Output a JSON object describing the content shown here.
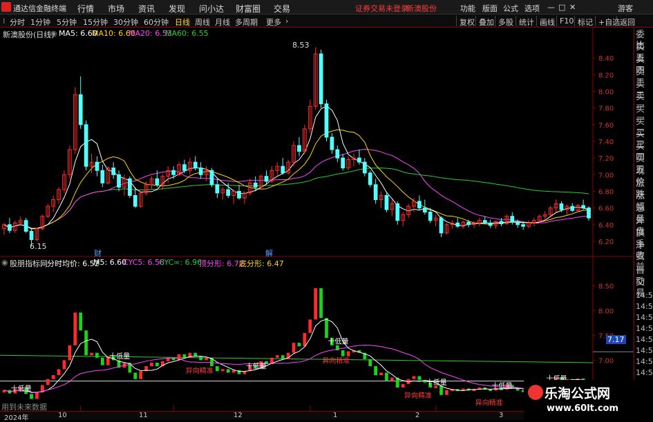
{
  "titlebar": {
    "app": "通达信金融终端",
    "menu": [
      "行情",
      "市场",
      "资讯",
      "发现",
      "问小达",
      "财富圈",
      "交易"
    ],
    "alert1": "证券交易未登录",
    "alert2": "新澳股份",
    "right": [
      "功能",
      "版面",
      "公式",
      "选项"
    ],
    "guest": "游客",
    "win": [
      "—",
      "□",
      "✕"
    ]
  },
  "tabs": {
    "items": [
      "分时",
      "1分钟",
      "5分钟",
      "15分钟",
      "30分钟",
      "60分钟",
      "日线",
      "周线",
      "月线",
      "多周期",
      "更多"
    ],
    "active": 6,
    "right": [
      "复权",
      "叠加",
      "多股",
      "统计",
      "画线",
      "F10",
      "标记",
      "+自选",
      "返回"
    ]
  },
  "main": {
    "title": "新澳股份(日线)",
    "ma5": "MA5: 6.60",
    "ma10": "MA10: 6.60",
    "ma20": "MA20: 6.53",
    "ma60": "MA60: 6.55",
    "hi_label": "8.53",
    "lo_label": "6.15",
    "mark1": "财",
    "mark2": "解"
  },
  "sub": {
    "title": "股朋指标网",
    "avg": "分时均价: 6.52",
    "m5": "M5: 6.60",
    "cyc5": "CYC5: 6.58",
    "cycinf": "CYC∞: 6.96",
    "top": "顶分形: 6.72",
    "bot": "底分形: 6.47",
    "last": "7.17",
    "future": "用到未来数据"
  },
  "rightpanel": {
    "items": [
      "委比",
      "卖五",
      "卖四",
      "卖三",
      "卖二",
      "卖一",
      "买一",
      "买二",
      "买三",
      "买四",
      "买五",
      "现价",
      "涨跌",
      "涨幅",
      "总量",
      "外盘",
      "换手",
      "净资",
      "收益"
    ],
    "sub": [
      "自动",
      "交易"
    ],
    "times": [
      "14:56",
      "14:56",
      "14:56",
      "14:56",
      "14:56",
      "14:56",
      "14:56",
      "14:56"
    ]
  },
  "xaxis": {
    "labels": [
      "2024年",
      "10",
      "11",
      "12",
      "1",
      "2",
      "3"
    ]
  },
  "watermark": {
    "t1": "乐淘公式网",
    "t2": "www.60lt.com"
  },
  "colors": {
    "up": "#ff2b2b",
    "down": "#54ffff",
    "ma5": "#ffffff",
    "ma10": "#ffd700",
    "ma20": "#ff44ff",
    "ma60": "#2ecc2e",
    "green": "#17d617"
  },
  "chart_data": [
    {
      "type": "candlestick",
      "title": "新澳股份(日线)",
      "ylim": [
        6.1,
        8.6
      ],
      "yticks": [
        6.2,
        6.4,
        6.6,
        6.8,
        7.0,
        7.2,
        7.4,
        7.6,
        7.8,
        8.0,
        8.2,
        8.4
      ],
      "x_labels": [
        "2024年",
        "10",
        "11",
        "12",
        "1",
        "2",
        "3"
      ],
      "ohlc": [
        [
          6.35,
          6.42,
          6.28,
          6.4
        ],
        [
          6.4,
          6.48,
          6.3,
          6.33
        ],
        [
          6.33,
          6.45,
          6.3,
          6.42
        ],
        [
          6.42,
          6.5,
          6.38,
          6.45
        ],
        [
          6.45,
          6.48,
          6.3,
          6.32
        ],
        [
          6.32,
          6.35,
          6.15,
          6.22
        ],
        [
          6.22,
          6.36,
          6.2,
          6.35
        ],
        [
          6.35,
          6.52,
          6.33,
          6.5
        ],
        [
          6.5,
          6.65,
          6.48,
          6.62
        ],
        [
          6.62,
          6.75,
          6.55,
          6.7
        ],
        [
          6.7,
          6.85,
          6.65,
          6.82
        ],
        [
          6.82,
          7.05,
          6.78,
          7.0
        ],
        [
          7.0,
          7.35,
          6.95,
          7.3
        ],
        [
          7.3,
          8.05,
          7.25,
          7.96
        ],
        [
          7.96,
          8.18,
          7.55,
          7.6
        ],
        [
          7.6,
          7.65,
          7.05,
          7.1
        ],
        [
          7.1,
          7.25,
          7.02,
          7.15
        ],
        [
          7.15,
          7.22,
          6.98,
          7.05
        ],
        [
          7.05,
          7.12,
          6.85,
          6.9
        ],
        [
          6.9,
          7.1,
          6.88,
          7.08
        ],
        [
          7.08,
          7.15,
          6.95,
          7.0
        ],
        [
          7.0,
          7.05,
          6.8,
          6.85
        ],
        [
          6.85,
          7.0,
          6.75,
          6.95
        ],
        [
          6.95,
          6.98,
          6.72,
          6.75
        ],
        [
          6.75,
          6.85,
          6.6,
          6.62
        ],
        [
          6.62,
          6.8,
          6.6,
          6.78
        ],
        [
          6.78,
          6.92,
          6.75,
          6.88
        ],
        [
          6.88,
          6.98,
          6.82,
          6.95
        ],
        [
          6.95,
          7.05,
          6.85,
          6.88
        ],
        [
          6.88,
          7.0,
          6.82,
          6.98
        ],
        [
          6.98,
          7.1,
          6.9,
          7.05
        ],
        [
          7.05,
          7.1,
          6.95,
          7.0
        ],
        [
          7.0,
          7.15,
          6.98,
          7.12
        ],
        [
          7.12,
          7.18,
          7.02,
          7.05
        ],
        [
          7.05,
          7.2,
          7.0,
          7.15
        ],
        [
          7.15,
          7.22,
          7.05,
          7.08
        ],
        [
          7.08,
          7.15,
          6.95,
          7.0
        ],
        [
          7.0,
          7.1,
          6.92,
          7.05
        ],
        [
          7.05,
          7.08,
          6.85,
          6.88
        ],
        [
          6.88,
          6.95,
          6.72,
          6.78
        ],
        [
          6.78,
          6.85,
          6.7,
          6.82
        ],
        [
          6.82,
          6.9,
          6.72,
          6.75
        ],
        [
          6.75,
          6.82,
          6.65,
          6.8
        ],
        [
          6.8,
          6.88,
          6.7,
          6.72
        ],
        [
          6.72,
          6.8,
          6.65,
          6.78
        ],
        [
          6.78,
          6.95,
          6.75,
          6.9
        ],
        [
          6.9,
          6.98,
          6.8,
          6.85
        ],
        [
          6.85,
          7.0,
          6.82,
          6.98
        ],
        [
          6.98,
          7.05,
          6.88,
          6.92
        ],
        [
          6.92,
          7.1,
          6.9,
          7.05
        ],
        [
          7.05,
          7.15,
          6.98,
          7.1
        ],
        [
          7.1,
          7.2,
          7.0,
          7.02
        ],
        [
          7.02,
          7.18,
          7.0,
          7.15
        ],
        [
          7.15,
          7.4,
          7.1,
          7.35
        ],
        [
          7.35,
          7.45,
          7.22,
          7.28
        ],
        [
          7.28,
          7.6,
          7.25,
          7.55
        ],
        [
          7.55,
          7.9,
          7.5,
          7.82
        ],
        [
          7.82,
          8.53,
          7.78,
          8.45
        ],
        [
          8.45,
          8.5,
          7.8,
          7.85
        ],
        [
          7.85,
          7.9,
          7.4,
          7.45
        ],
        [
          7.45,
          7.5,
          7.25,
          7.3
        ],
        [
          7.3,
          7.35,
          7.15,
          7.2
        ],
        [
          7.2,
          7.25,
          7.05,
          7.08
        ],
        [
          7.08,
          7.22,
          7.05,
          7.18
        ],
        [
          7.18,
          7.25,
          7.1,
          7.2
        ],
        [
          7.2,
          7.3,
          7.12,
          7.15
        ],
        [
          7.15,
          7.2,
          6.98,
          7.02
        ],
        [
          7.02,
          7.05,
          6.85,
          6.88
        ],
        [
          6.88,
          6.95,
          6.65,
          6.7
        ],
        [
          6.7,
          6.8,
          6.6,
          6.75
        ],
        [
          6.75,
          6.78,
          6.55,
          6.58
        ],
        [
          6.58,
          6.7,
          6.5,
          6.65
        ],
        [
          6.65,
          6.68,
          6.4,
          6.45
        ],
        [
          6.45,
          6.55,
          6.38,
          6.52
        ],
        [
          6.52,
          6.65,
          6.48,
          6.62
        ],
        [
          6.62,
          6.72,
          6.55,
          6.68
        ],
        [
          6.68,
          6.75,
          6.58,
          6.6
        ],
        [
          6.6,
          6.7,
          6.52,
          6.55
        ],
        [
          6.55,
          6.6,
          6.42,
          6.45
        ],
        [
          6.45,
          6.52,
          6.38,
          6.48
        ],
        [
          6.48,
          6.5,
          6.25,
          6.3
        ],
        [
          6.3,
          6.42,
          6.28,
          6.4
        ],
        [
          6.4,
          6.45,
          6.35,
          6.42
        ],
        [
          6.42,
          6.48,
          6.36,
          6.38
        ],
        [
          6.38,
          6.45,
          6.35,
          6.43
        ],
        [
          6.43,
          6.46,
          6.37,
          6.4
        ],
        [
          6.4,
          6.44,
          6.36,
          6.42
        ],
        [
          6.42,
          6.48,
          6.38,
          6.45
        ],
        [
          6.45,
          6.5,
          6.4,
          6.42
        ],
        [
          6.42,
          6.46,
          6.36,
          6.39
        ],
        [
          6.39,
          6.45,
          6.35,
          6.44
        ],
        [
          6.44,
          6.48,
          6.38,
          6.41
        ],
        [
          6.41,
          6.52,
          6.4,
          6.5
        ],
        [
          6.5,
          6.55,
          6.4,
          6.43
        ],
        [
          6.43,
          6.46,
          6.36,
          6.4
        ],
        [
          6.4,
          6.44,
          6.34,
          6.38
        ],
        [
          6.38,
          6.45,
          6.36,
          6.42
        ],
        [
          6.42,
          6.48,
          6.38,
          6.45
        ],
        [
          6.45,
          6.52,
          6.42,
          6.5
        ],
        [
          6.5,
          6.56,
          6.45,
          6.52
        ],
        [
          6.52,
          6.62,
          6.5,
          6.6
        ],
        [
          6.6,
          6.7,
          6.55,
          6.65
        ],
        [
          6.65,
          6.68,
          6.55,
          6.58
        ],
        [
          6.58,
          6.64,
          6.52,
          6.62
        ],
        [
          6.62,
          6.66,
          6.55,
          6.57
        ],
        [
          6.57,
          6.65,
          6.55,
          6.63
        ],
        [
          6.63,
          6.7,
          6.58,
          6.6
        ],
        [
          6.6,
          6.62,
          6.45,
          6.48
        ]
      ],
      "series_ma": [
        {
          "name": "MA5",
          "last": 6.6
        },
        {
          "name": "MA10",
          "last": 6.6
        },
        {
          "name": "MA20",
          "last": 6.53
        },
        {
          "name": "MA60",
          "last": 6.55
        }
      ]
    },
    {
      "type": "bar",
      "title": "股朋指标网",
      "ylim": [
        6.2,
        8.7
      ],
      "yticks": [
        7.0,
        7.5,
        8.0,
        8.5
      ],
      "level_line": 7.17,
      "labels": [
        "低量",
        "异向精准"
      ]
    }
  ]
}
